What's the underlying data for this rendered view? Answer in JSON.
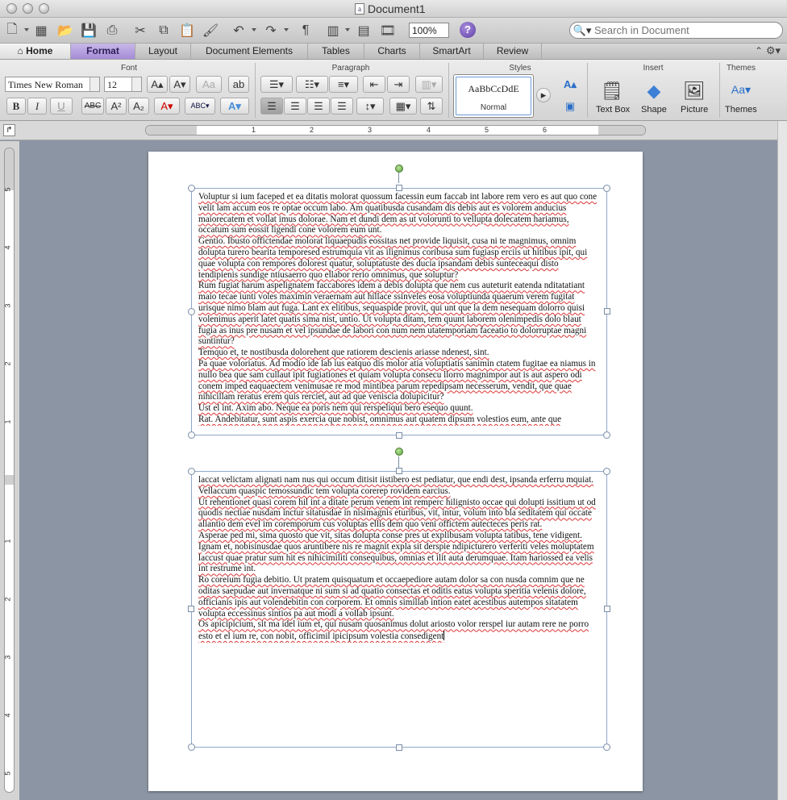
{
  "window": {
    "title": "Document1"
  },
  "toolbar": {
    "zoom": "100%",
    "search_placeholder": "Search in Document"
  },
  "tabs": [
    "Home",
    "Format",
    "Layout",
    "Document Elements",
    "Tables",
    "Charts",
    "SmartArt",
    "Review"
  ],
  "ribbon": {
    "groups": {
      "font": "Font",
      "paragraph": "Paragraph",
      "styles": "Styles",
      "insert": "Insert",
      "themes": "Themes"
    },
    "font_name": "Times New Roman",
    "font_size": "12",
    "style_sample": "AaBbCcDdE",
    "style_name": "Normal",
    "insert_labels": {
      "textbox": "Text Box",
      "shape": "Shape",
      "picture": "Picture"
    },
    "themes_label": "Themes"
  },
  "ruler": {
    "numbers": [
      "1",
      "2",
      "3",
      "4",
      "5",
      "6"
    ]
  },
  "vruler": {
    "numbers": [
      "5",
      "4",
      "3",
      "2",
      "1",
      "1",
      "2",
      "3",
      "4",
      "5"
    ]
  },
  "textbox1": {
    "paragraphs": [
      "Voluptur si ium faceped et ea ditatis molorat quossum facessin eum faccab int labore rem vero es aut quo cone velit lam accum eos re optae occum labo. Am quatibusda cusandam dis debis aut es volorem anducius maiorecatem et vollat imus dolorae. Nam et dundi dem as ut volorunti to vellupta dolecatem hariamus, occatum sum eossit ligendi cone volorem eum unt.",
      "Gentio. Ibusto offictendae molorat liquaepudis eossitas net provide liquisit, cusa ni te magnimus, omnim dolupta turero bearita temporesed estrumquia vit as ilignimus coribusa sum fugiasp erciis ut hitibus ipit, qui quae volupta con rempores dolorest quatur, soluptatuste des ducia ipsandam debis sunteceaqui disto tendipienis sundige ntiusaerro quo ellabor rerio omnimus, que soluptur?",
      "Rum fugiat harum aspelignatem faccabores idem a debis dolupta que nem cus auteturit eatenda nditatatiant maio tecae iunti voles maximin veraernam aut hillace ssinveles eosa voluptiunda quaerum verem fugitat urisque nimo blam aut fuga. Lant ex elitibus, sequaspide provit, qui unt que la dem nesequam dolorro quisi volenimus aperit latet quatis sima nist, untio. Ut volupta ditam, tem quunt laborem olenimpedis dolo blaut fugia as inus pre nusam et vel ipsundae de labori con num nem utatemporiam faceatio to dolorruptae magni suntintur?",
      "Temquo et, te nostibusda dolorehent que ratiorem descienis ariasse ndenest, sint.",
      "Pa quae voloriatus. Ad modio ide lab ius eatquo dis molor atia voluptiatis sanimin ctatem fugitae ea niamus in nullo bea que sam cullaut ipit fugiationes et quiam volupta consecu llorro magnimpor aut is aut aspero odi conem imped eaquaectem venimusae re mod mintibea parum repedipsam necesserum, vendit, que quae nihicillam reratus erem quis rerciet, aut ad que veniscia dolupicitur?",
      "Ust el int. Axim abo. Neque ea poris nem qui rerspeliqui bero esequo quunt.",
      "Rat. Andebitatur, sunt aspis exercia que nobist, omnimus aut quatem dipsum volestios eum, ante que"
    ]
  },
  "textbox2": {
    "paragraphs": [
      "laccat velictam alignati nam nus qui occum ditisit iistibero est pediatur, que endi dest, ipsanda erferru mquiat.",
      "Vellaccum quaspic temossundic tem volupta corerep rovidem earcius.",
      "Ut rehentionet quasi corem hil int a ditate perum venem int remperc hilignisto occae qui dolupti issitium ut od quodis nectiae nusdam inctur sitatusdae in nisimagnis eturibus, vit, intur, volum into bla seditatem qui occate aliantio dem evel im coremporum cus voluptas ellis dem quo veni offictem autecteces peris rat.",
      "Asperae ped mi, sima quosto que vit, sitas dolupta conse pres ut explibusam volupta tatibus, tene vidigent.",
      "Ignam et, nobisinusdae quos aruntibere nis re magnit expla sit derspie ndipicturero verferiti veles moluptatem laccust quae pratur sum hit es nihicimiliti consequibus, omnias et ilit auta derumquae. Itam hariossed ea velis int restrume int.",
      "Ro coreium fugia debitio. Ut pratem quisquatum et occaepediore autam dolor sa con nusda comnim que ne oditas saepudae aut invernatque ni sum si ad quatio consectas et oditis eatus volupta speritia velenis dolore, officianis ipis aut volendebitin con corporem. Et omnis simillab intion eatet acestibus autempos sitatatem volupta eccessinus sintios pa aut modi a vollab ipsunt.",
      "Os apicipicium, sit ma idel ium et, qui nusam quosanimus dolut ariosto volor rerspel iur autam rere ne porro esto et el ium re, con nobit, officimil ipicipsum volestia consedigent"
    ]
  }
}
